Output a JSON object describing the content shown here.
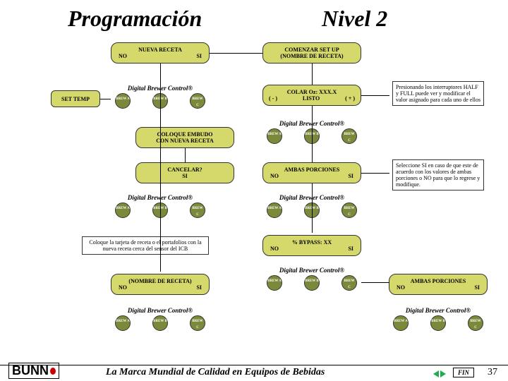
{
  "header": {
    "left": "Programación",
    "right": "Nivel 2"
  },
  "nuevaReceta": {
    "title": "NUEVA RECETA",
    "no": "NO",
    "si": "SI"
  },
  "comenzar": {
    "l1": "COMENZAR SET UP",
    "l2": "(NOMBRE DE RECETA)"
  },
  "setTemp": "SET TEMP",
  "colar": {
    "title": "COLAR Oz: XXX.X",
    "minus": "( - )",
    "listo": "LISTO",
    "plus": "( + )"
  },
  "note1": "Presionando los interruptores HALF y FULL puede ver y modificar el valor asignado para cada uno de ellos",
  "coloque": {
    "l1": "COLOQUE EMBUDO",
    "l2": "CON NUEVA RECETA"
  },
  "cancelar": {
    "title": "CANCELAR?",
    "si": "SI"
  },
  "ambas": {
    "title": "AMBAS PORCIONES",
    "no": "NO",
    "si": "SI"
  },
  "note2": "Seleccione SI en caso de que este de acuerdo con los valores de ambas porciones o NO para que lo regrese y modifique.",
  "tarjeta": "Coloque la tarjeta de receta o el portafolios con la nueva receta cerca del sensor del ICB",
  "bypass": {
    "title": "% BYPASS: XX",
    "no": "NO",
    "si": "SI"
  },
  "nombreReceta": {
    "title": "(NOMBRE DE RECETA)",
    "no": "NO",
    "si": "SI"
  },
  "dbc": {
    "label": "Digital  Brewer  Control®",
    "a": "BREW A",
    "b": "BREW B",
    "c": "BREW C"
  },
  "footer": {
    "brand": "BUNN",
    "tag": "La Marca Mundial de Calidad en Equipos de Bebidas",
    "fin": "FIN",
    "page": "37"
  }
}
